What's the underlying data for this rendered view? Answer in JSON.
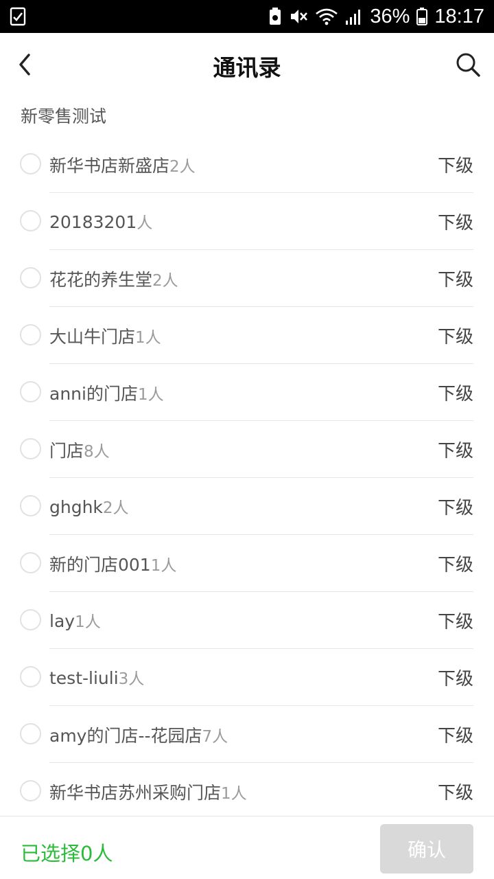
{
  "status_bar": {
    "battery": "36%",
    "time": "18:17",
    "icons": [
      "clipboard-check-icon",
      "battery-saver-icon",
      "mute-icon",
      "wifi-icon",
      "signal-icon",
      "battery-icon"
    ]
  },
  "header": {
    "title": "通讯录",
    "back_icon": "chevron-left-icon",
    "search_icon": "search-icon"
  },
  "section_title": "新零售测试",
  "stores": [
    {
      "name": "新华书店新盛店",
      "count": "2人",
      "action": "下级"
    },
    {
      "name": "20183201",
      "count": "人",
      "action": "下级"
    },
    {
      "name": "花花的养生堂",
      "count": "2人",
      "action": "下级"
    },
    {
      "name": "大山牛门店",
      "count": "1人",
      "action": "下级"
    },
    {
      "name": "anni的门店",
      "count": "1人",
      "action": "下级"
    },
    {
      "name": "门店",
      "count": "8人",
      "action": "下级"
    },
    {
      "name": "ghghk",
      "count": "2人",
      "action": "下级"
    },
    {
      "name": "新的门店001",
      "count": "1人",
      "action": "下级"
    },
    {
      "name": "lay",
      "count": "1人",
      "action": "下级"
    },
    {
      "name": "test-liuli",
      "count": "3人",
      "action": "下级"
    },
    {
      "name": "amy的门店--花园店",
      "count": "7人",
      "action": "下级"
    },
    {
      "name": "新华书店苏州采购门店",
      "count": "1人",
      "action": "下级"
    }
  ],
  "footer": {
    "selected_label": "已选择0人",
    "confirm_label": "确认"
  },
  "colors": {
    "accent_green": "#2bbb3a",
    "disabled_button": "#d9d9d9",
    "divider": "#e6e6e6"
  }
}
